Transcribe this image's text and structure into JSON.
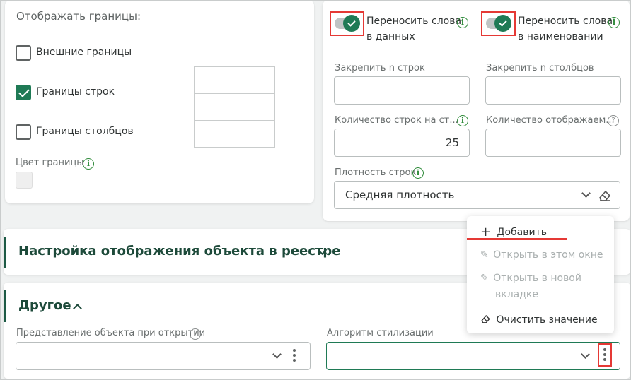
{
  "borders": {
    "title": "Отображать границы:",
    "outer": {
      "label": "Внешние границы",
      "checked": false
    },
    "rows": {
      "label": "Границы строк",
      "checked": true
    },
    "cols": {
      "label": "Границы столбцов",
      "checked": false
    },
    "color_label": "Цвет границы"
  },
  "settings": {
    "wrap_data": {
      "label_line1": "Переносить слова",
      "label_line2": "в данных",
      "on": true
    },
    "wrap_names": {
      "label_line1": "Переносить слова",
      "label_line2": "в наименовании",
      "on": true
    },
    "pin_rows_label": "Закрепить n строк",
    "pin_cols_label": "Закрепить n столбцов",
    "rows_count_label": "Количество строк на ст...",
    "rows_count_value": "25",
    "shown_count_label": "Количество отображаем...",
    "density_label": "Плотность строк",
    "density_value": "Средняя плотность"
  },
  "sections": {
    "display_title": "Настройка отображения объекта в реестре",
    "other_title": "Другое",
    "open_view_label": "Представление объекта при открытии",
    "style_algo_label": "Алгоритм стилизации"
  },
  "menu": {
    "add": "Добавить",
    "open_here": "Открыть в этом окне",
    "open_new_line1": "Открыть в новой",
    "open_new_line2": "вкладке",
    "clear": "Очистить значение"
  },
  "colors": {
    "accent": "#1f7a55",
    "highlight": "#e53935",
    "info": "#2f8b3a"
  }
}
